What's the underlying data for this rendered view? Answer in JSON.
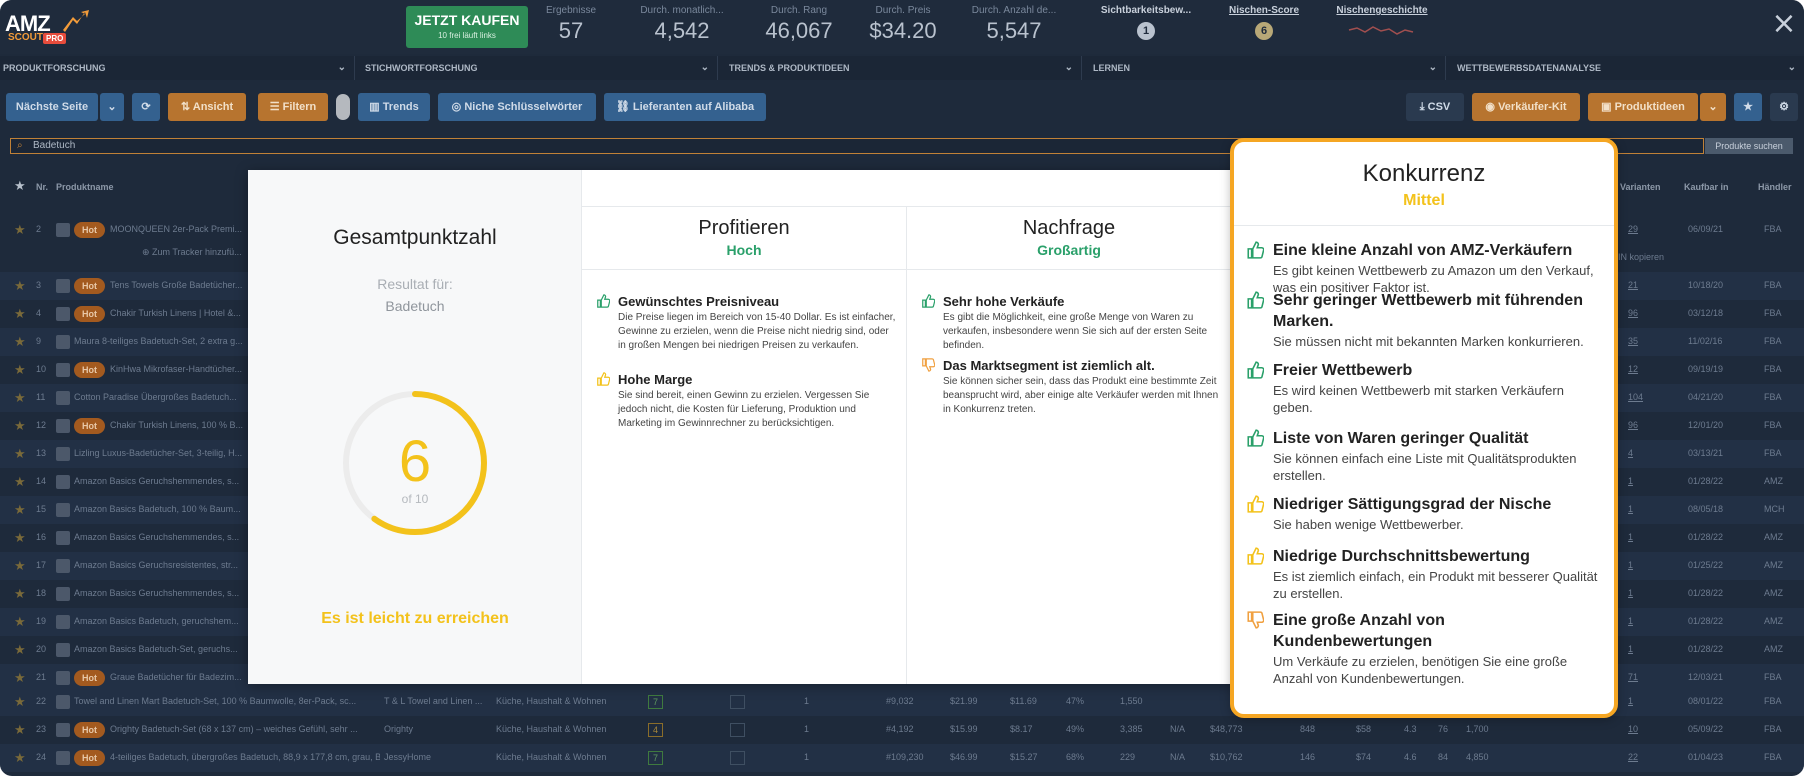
{
  "logo": {
    "amz": "AMZ",
    "scout": "SCOUT",
    "pro": "PRO"
  },
  "buy": {
    "label": "JETZT KAUFEN",
    "sub": "10 frei läuft links"
  },
  "stats": [
    {
      "label": "Ergebnisse",
      "value": "57"
    },
    {
      "label": "Durch. monatlich...",
      "value": "4,542"
    },
    {
      "label": "Durch. Rang",
      "value": "46,067"
    },
    {
      "label": "Durch. Preis",
      "value": "$34.20"
    },
    {
      "label": "Durch. Anzahl de...",
      "value": "5,547"
    }
  ],
  "visibility": {
    "label": "Sichtbarkeitsbew...",
    "value": "1"
  },
  "niche_score": {
    "label": "Nischen-Score",
    "value": "6"
  },
  "niche_history": {
    "label": "Nischengeschichte"
  },
  "categories": [
    "PRODUKTFORSCHUNG",
    "STICHWORTFORSCHUNG",
    "TRENDS & PRODUKTIDEEN",
    "LERNEN",
    "WETTBEWERBSDATENANALYSE"
  ],
  "toolbar": {
    "next_page": "Nächste Seite",
    "view": "Ansicht",
    "filter": "Filtern",
    "trends": "Trends",
    "niche_keywords": "Niche Schlüsselwörter",
    "suppliers": "Lieferanten auf Alibaba",
    "csv": "CSV",
    "seller_kit": "Verkäufer-Kit",
    "product_ideas": "Produktideen"
  },
  "search": {
    "value": "Badetuch",
    "button": "Produkte suchen"
  },
  "table": {
    "headers": [
      "Nr.",
      "Produktname",
      "Varianten",
      "Kaufbar in",
      "Händler"
    ],
    "tracker_text": "Zum Tracker hinzufü...",
    "asin_copy": "IN kopieren",
    "rows": [
      {
        "nr": "2",
        "hot": true,
        "name": "MOONQUEEN 2er-Pack Premi...",
        "variants": "29",
        "date": "06/09/21",
        "seller": "FBA"
      },
      {
        "nr": "3",
        "hot": true,
        "name": "Tens Towels Große Badetücher...",
        "variants": "21",
        "date": "10/18/20",
        "seller": "FBA"
      },
      {
        "nr": "4",
        "hot": true,
        "name": "Chakir Turkish Linens | Hotel &...",
        "variants": "96",
        "date": "03/12/18",
        "seller": "FBA"
      },
      {
        "nr": "9",
        "hot": false,
        "name": "Maura 8-teiliges Badetuch-Set, 2 extra g...",
        "variants": "35",
        "date": "11/02/16",
        "seller": "FBA"
      },
      {
        "nr": "10",
        "hot": true,
        "name": "KinHwa Mikrofaser-Handtücher...",
        "variants": "12",
        "date": "09/19/19",
        "seller": "FBA"
      },
      {
        "nr": "11",
        "hot": false,
        "name": "Cotton Paradise Übergroßes Badetuch...",
        "variants": "104",
        "date": "04/21/20",
        "seller": "FBA"
      },
      {
        "nr": "12",
        "hot": true,
        "name": "Chakir Turkish Linens, 100 % B...",
        "variants": "96",
        "date": "12/01/20",
        "seller": "FBA"
      },
      {
        "nr": "13",
        "hot": false,
        "name": "Lizling Luxus-Badetücher-Set, 3-teilig, H...",
        "variants": "4",
        "date": "03/13/21",
        "seller": "FBA"
      },
      {
        "nr": "14",
        "hot": false,
        "name": "Amazon Basics Geruchshemmendes, s...",
        "variants": "1",
        "date": "01/28/22",
        "seller": "AMZ"
      },
      {
        "nr": "15",
        "hot": false,
        "name": "Amazon Basics Badetuch, 100 % Baum...",
        "variants": "1",
        "date": "08/05/18",
        "seller": "MCH"
      },
      {
        "nr": "16",
        "hot": false,
        "name": "Amazon Basics Geruchshemmendes, s...",
        "variants": "1",
        "date": "01/28/22",
        "seller": "AMZ"
      },
      {
        "nr": "17",
        "hot": false,
        "name": "Amazon Basics Geruchsresistentes, str...",
        "variants": "1",
        "date": "01/25/22",
        "seller": "AMZ"
      },
      {
        "nr": "18",
        "hot": false,
        "name": "Amazon Basics Geruchshemmendes, s...",
        "variants": "1",
        "date": "01/28/22",
        "seller": "AMZ"
      },
      {
        "nr": "19",
        "hot": false,
        "name": "Amazon Basics Badetuch, geruchshem...",
        "variants": "1",
        "date": "01/28/22",
        "seller": "AMZ"
      },
      {
        "nr": "20",
        "hot": false,
        "name": "Amazon Basics Badetuch-Set, geruchs...",
        "variants": "1",
        "date": "01/28/22",
        "seller": "AMZ"
      },
      {
        "nr": "21",
        "hot": true,
        "name": "Graue Badetücher für Badezim...",
        "variants": "71",
        "date": "12/03/21",
        "seller": "FBA"
      }
    ],
    "full_rows": [
      {
        "nr": "22",
        "hot": false,
        "name": "Towel and Linen Mart Badetuch-Set, 100 % Baumwolle, 8er-Pack, sc...",
        "brand": "T & L Towel and Linen ...",
        "category": "Küche, Haushalt & Wohnen",
        "score": "7",
        "b1": "1",
        "rank": "#9,032",
        "price": "$21.99",
        "fba": "$11.69",
        "net": "47%",
        "reviews": "1,550",
        "na": "",
        "revenue": "",
        "sales": "",
        "c1": "",
        "rating": "",
        "r2": "",
        "r3": "",
        "variants": "1",
        "date": "08/01/22",
        "seller": "FBA",
        "badge": "g"
      },
      {
        "nr": "23",
        "hot": true,
        "name": "Orighty Badetuch-Set (68 x 137 cm) – weiches Gefühl, sehr ...",
        "brand": "Orighty",
        "category": "Küche, Haushalt & Wohnen",
        "score": "4",
        "b1": "1",
        "rank": "#4,192",
        "price": "$15.99",
        "fba": "$8.17",
        "net": "49%",
        "reviews": "3,385",
        "na": "N/A",
        "revenue": "$48,773",
        "sales": "848",
        "c1": "$58",
        "rating": "4.3",
        "r2": "76",
        "r3": "1,700",
        "variants": "10",
        "date": "05/09/22",
        "seller": "FBA",
        "badge": "o"
      },
      {
        "nr": "24",
        "hot": true,
        "name": "4-teiliges Badetuch, übergroßes Badetuch, 88,9 x 177,8 cm, grau, B...",
        "brand": "JessyHome",
        "category": "Küche, Haushalt & Wohnen",
        "score": "7",
        "b1": "1",
        "rank": "#109,230",
        "price": "$46.99",
        "fba": "$15.27",
        "net": "68%",
        "reviews": "229",
        "na": "N/A",
        "revenue": "$10,762",
        "sales": "146",
        "c1": "$74",
        "rating": "4.6",
        "r2": "84",
        "r3": "4,850",
        "variants": "22",
        "date": "01/04/23",
        "seller": "FBA",
        "badge": "g"
      }
    ]
  },
  "modal": {
    "score_title": "Gesamtpunktzahl",
    "result_for": "Resultat für:",
    "query": "Badetuch",
    "score": 6,
    "score_value": "6",
    "score_of": "of 10",
    "summary": "Es ist leicht zu erreichen",
    "columns": [
      {
        "title": "Profitieren",
        "rating": "Hoch",
        "items": [
          {
            "kind": "up-green",
            "title": "Gewünschtes Preisniveau",
            "text": "Die Preise liegen im Bereich von 15-40 Dollar. Es ist einfacher, Gewinne zu erzielen, wenn die Preise nicht niedrig sind, oder in großen Mengen bei niedrigen Preisen zu verkaufen."
          },
          {
            "kind": "up-yellow",
            "title": "Hohe Marge",
            "text": "Sie sind bereit, einen Gewinn zu erzielen. Vergessen Sie jedoch nicht, die Kosten für Lieferung, Produktion und Marketing im Gewinnrechner zu berücksichtigen."
          }
        ]
      },
      {
        "title": "Nachfrage",
        "rating": "Großartig",
        "items": [
          {
            "kind": "up-green",
            "title": "Sehr hohe Verkäufe",
            "text": "Es gibt die Möglichkeit, eine große Menge von Waren zu verkaufen, insbesondere wenn Sie sich auf der ersten Seite befinden."
          },
          {
            "kind": "down-orange",
            "title": "Das Marktsegment ist ziemlich alt.",
            "text": "Sie können sicher sein, dass das Produkt eine bestimmte Zeit beansprucht wird, aber einige alte Verkäufer werden mit Ihnen in Konkurrenz treten."
          }
        ]
      }
    ]
  },
  "konkurrenz": {
    "title": "Konkurrenz",
    "rating": "Mittel",
    "items": [
      {
        "kind": "up-green",
        "title": "Eine kleine Anzahl von AMZ-Verkäufern",
        "text": "Es gibt keinen Wettbewerb zu Amazon um den Verkauf, was ein positiver Faktor ist."
      },
      {
        "kind": "up-green",
        "title": "Sehr geringer Wettbewerb mit führenden Marken.",
        "text": "Sie müssen nicht mit bekannten Marken konkurrieren."
      },
      {
        "kind": "up-green",
        "title": "Freier Wettbewerb",
        "text": "Es wird keinen Wettbewerb mit starken Verkäufern geben."
      },
      {
        "kind": "up-green",
        "title": "Liste von Waren geringer Qualität",
        "text": "Sie können einfach eine Liste mit Qualitätsprodukten erstellen."
      },
      {
        "kind": "up-yellow",
        "title": "Niedriger Sättigungsgrad der Nische",
        "text": "Sie haben wenige Wettbewerber."
      },
      {
        "kind": "up-yellow",
        "title": "Niedrige Durchschnittsbewertung",
        "text": "Es ist ziemlich einfach, ein Produkt mit besserer Qualität zu erstellen."
      },
      {
        "kind": "down-orange",
        "title": "Eine große Anzahl von Kundenbewertungen",
        "text": "Um Verkäufe zu erzielen, benötigen Sie eine große Anzahl von Kundenbewertungen."
      }
    ]
  },
  "colors": {
    "accent_orange": "#f5a623",
    "good_green": "#2aa06a",
    "score_yellow": "#f3c21b",
    "bad_orange": "#f0a040"
  }
}
